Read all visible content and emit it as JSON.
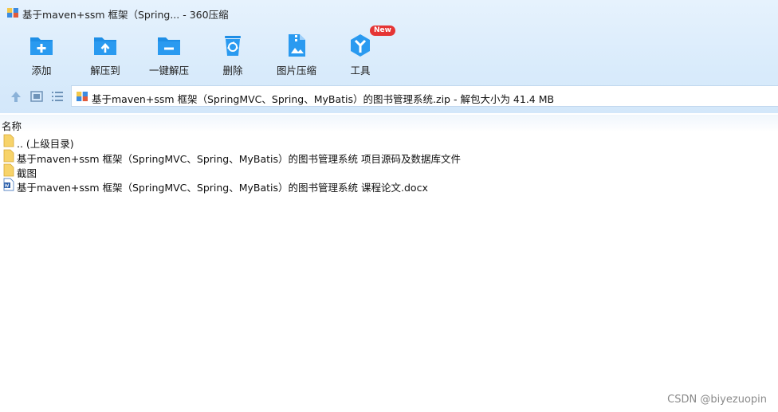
{
  "window": {
    "title": "基于maven+ssm 框架（Spring... - 360压缩",
    "app_icon": "archive-icon"
  },
  "toolbar": {
    "buttons": [
      {
        "label": "添加",
        "icon": "add-folder-icon"
      },
      {
        "label": "解压到",
        "icon": "extract-to-icon"
      },
      {
        "label": "一键解压",
        "icon": "one-click-extract-icon"
      },
      {
        "label": "删除",
        "icon": "recycle-bin-icon"
      },
      {
        "label": "图片压缩",
        "icon": "image-compress-icon"
      },
      {
        "label": "工具",
        "icon": "tools-icon",
        "badge": "New"
      }
    ]
  },
  "nav": {
    "path": "基于maven+ssm 框架（SpringMVC、Spring、MyBatis）的图书管理系统.zip - 解包大小为 41.4 MB"
  },
  "list": {
    "column_name": "名称",
    "rows": [
      {
        "name": ".. (上级目录)",
        "icon": "folder-icon"
      },
      {
        "name": "基于maven+ssm 框架（SpringMVC、Spring、MyBatis）的图书管理系统 项目源码及数据库文件",
        "icon": "folder-icon"
      },
      {
        "name": "截图",
        "icon": "folder-icon"
      },
      {
        "name": "基于maven+ssm 框架（SpringMVC、Spring、MyBatis）的图书管理系统 课程论文.docx",
        "icon": "word-doc-icon"
      }
    ]
  },
  "watermark": "CSDN @biyezuopin",
  "colors": {
    "toolbar_bg": "#d9ebfb",
    "icon_blue": "#1e8ee6",
    "badge_red": "#e53535",
    "folder_yellow": "#f7d36a"
  }
}
